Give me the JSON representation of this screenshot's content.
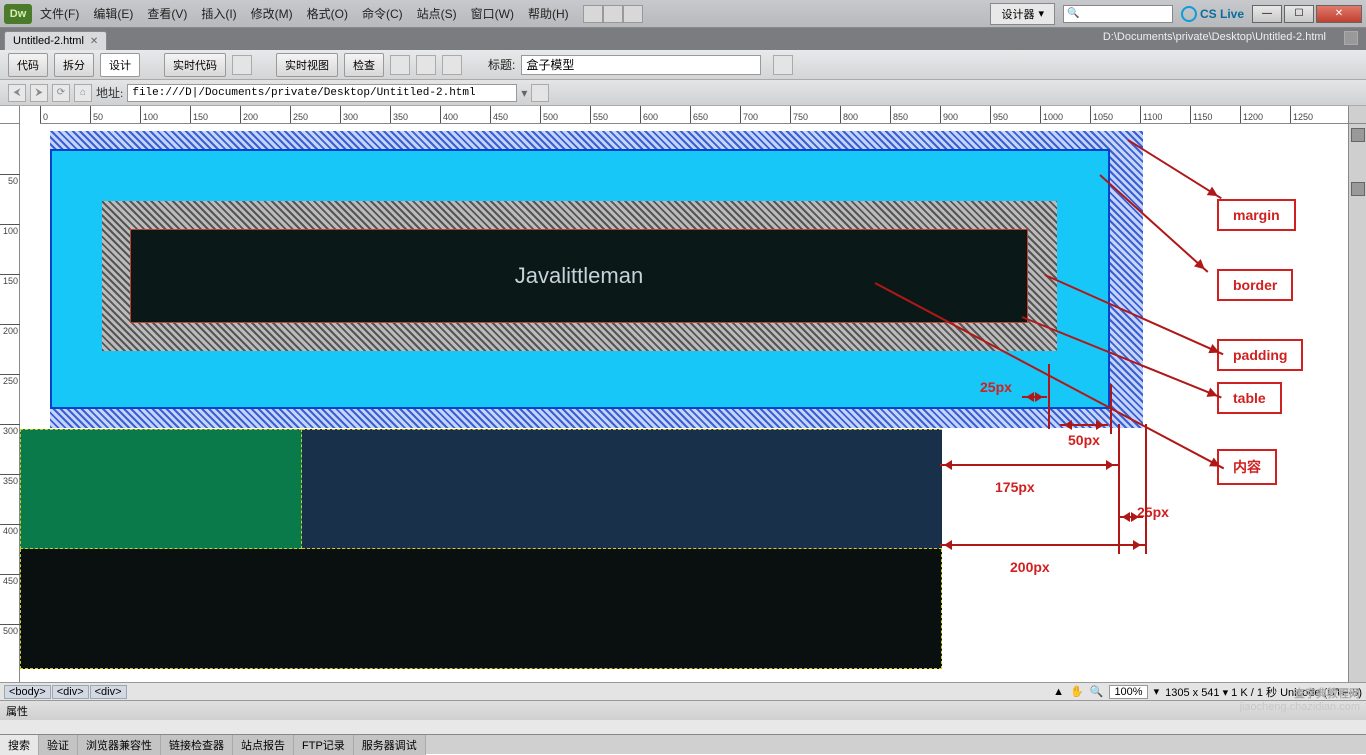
{
  "app": {
    "logo": "Dw"
  },
  "menu": [
    "文件(F)",
    "编辑(E)",
    "查看(V)",
    "插入(I)",
    "修改(M)",
    "格式(O)",
    "命令(C)",
    "站点(S)",
    "窗口(W)",
    "帮助(H)"
  ],
  "titlebar": {
    "designer": "设计器",
    "cslive": "CS Live"
  },
  "doctab": {
    "name": "Untitled-2.html",
    "path": "D:\\Documents\\private\\Desktop\\Untitled-2.html"
  },
  "toolbar": {
    "code": "代码",
    "split": "拆分",
    "design": "设计",
    "live_code": "实时代码",
    "live_view": "实时视图",
    "inspect": "检查",
    "title_label": "标题:",
    "title_value": "盒子模型"
  },
  "addrbar": {
    "label": "地址:",
    "url": "file:///D|/Documents/private/Desktop/Untitled-2.html"
  },
  "ruler_ticks": [
    0,
    50,
    100,
    150,
    200,
    250,
    300,
    350,
    400,
    450,
    500,
    550,
    600,
    650,
    700,
    750,
    800,
    850,
    900,
    950,
    1000,
    1050,
    1100,
    1150,
    1200,
    1250
  ],
  "ruler_vticks": [
    50,
    100,
    150,
    200,
    250,
    300,
    350,
    400,
    450,
    500
  ],
  "content_text": "Javalittleman",
  "annotations": {
    "margin": "margin",
    "border": "border",
    "padding": "padding",
    "table": "table",
    "content": "内容"
  },
  "dimensions": {
    "d25a": "25px",
    "d50": "50px",
    "d175": "175px",
    "d25b": "25px",
    "d200": "200px"
  },
  "tagselector": [
    "<body>",
    "<div>",
    "<div>"
  ],
  "status": {
    "zoom": "100%",
    "info": "1305 x 541 ▾ 1 K / 1 秒 Unicode (UTF-8)"
  },
  "properties_label": "属性",
  "bottom_tabs": [
    "搜索",
    "验证",
    "浏览器兼容性",
    "链接检查器",
    "站点报告",
    "FTP记录",
    "服务器调试"
  ],
  "watermark": {
    "l1": "查字典教程网",
    "l2": "jiaocheng.chazidian.com"
  }
}
